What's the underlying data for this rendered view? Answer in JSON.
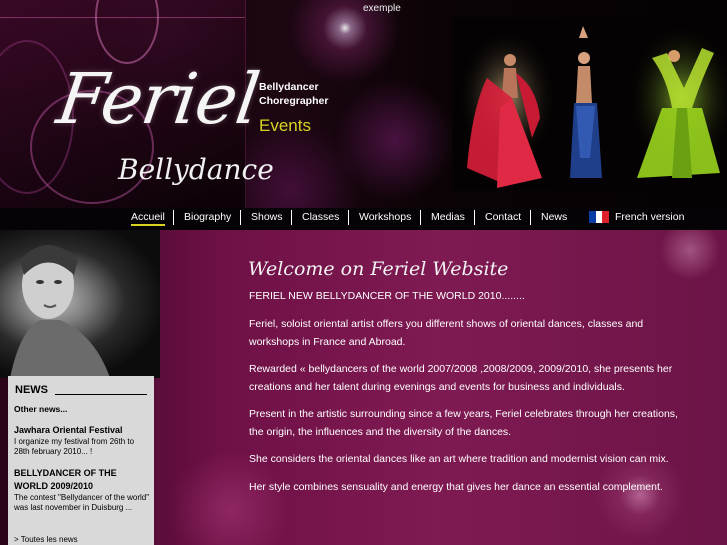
{
  "header": {
    "top_text": "exemple",
    "logo_title": "Feriel",
    "logo_subtitle": "Bellydance",
    "tagline_line1": "Bellydancer",
    "tagline_line2": "Choregrapher",
    "events_label": "Events"
  },
  "nav": {
    "items": [
      {
        "label": "Accueil",
        "active": true
      },
      {
        "label": "Biography"
      },
      {
        "label": "Shows"
      },
      {
        "label": "Classes"
      },
      {
        "label": "Workshops"
      },
      {
        "label": "Medias"
      },
      {
        "label": "Contact"
      },
      {
        "label": "News"
      }
    ],
    "language_label": "French version",
    "flag_colors": [
      "#0a3ea6",
      "#ffffff",
      "#e0202a"
    ]
  },
  "main": {
    "welcome_title": "Welcome on Feriel Website",
    "intro": "FERIEL NEW BELLYDANCER OF THE WORLD 2010........",
    "paragraphs": [
      "Feriel, soloist oriental artist offers you different shows of oriental dances, classes and workshops in France and Abroad.",
      "Rewarded « bellydancers of the world 2007/2008 ,2008/2009, 2009/2010, she presents her creations and her talent during evenings and events for business and individuals.",
      "Present in the artistic surrounding since a few years, Feriel celebrates through her creations, the origin, the influences and the diversity of the dances.",
      "She considers the oriental dances like an art where tradition and modernist vision can mix.",
      "Her style combines sensuality and energy that gives her dance an essential complement."
    ]
  },
  "news": {
    "title": "NEWS",
    "other": "Other news...",
    "items": [
      {
        "heading": "Jawhara Oriental Festival",
        "text": "I organize my festival from 26th to 28th february 2010... !"
      },
      {
        "heading": "BELLYDANCER OF THE WORLD 2009/2010",
        "text": "The contest \"Bellydancer of the world\" was last november in Duisburg ..."
      }
    ],
    "more_link": "> Toutes les news"
  },
  "colors": {
    "accent_yellow": "#d8d320",
    "content_magenta": "#7f1a52",
    "news_bg": "#d9d9d9"
  }
}
